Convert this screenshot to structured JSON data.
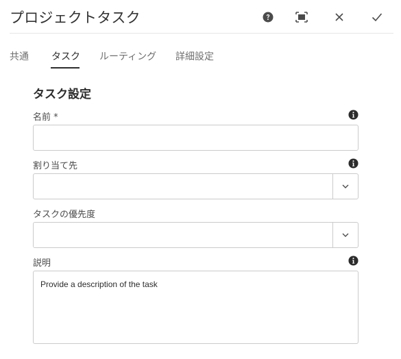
{
  "dialog": {
    "title": "プロジェクトタスク",
    "header_buttons": {
      "help": "help-icon",
      "fullscreen": "fullscreen-icon",
      "close": "close-icon",
      "confirm": "checkmark-icon"
    }
  },
  "tabs": [
    {
      "label": "共通",
      "active": false
    },
    {
      "label": "タスク",
      "active": true
    },
    {
      "label": "ルーティング",
      "active": false
    },
    {
      "label": "詳細設定",
      "active": false
    }
  ],
  "form": {
    "section_title": "タスク設定",
    "name": {
      "label": "名前 *",
      "value": ""
    },
    "assignee": {
      "label": "割り当て先",
      "value": ""
    },
    "priority": {
      "label": "タスクの優先度",
      "value": ""
    },
    "description": {
      "label": "説明",
      "value": "Provide a description of the task"
    }
  },
  "colors": {
    "border": "#cacaca",
    "text": "#2c2c2c",
    "muted": "#6e6e6e",
    "icon": "#4b4b4b"
  }
}
